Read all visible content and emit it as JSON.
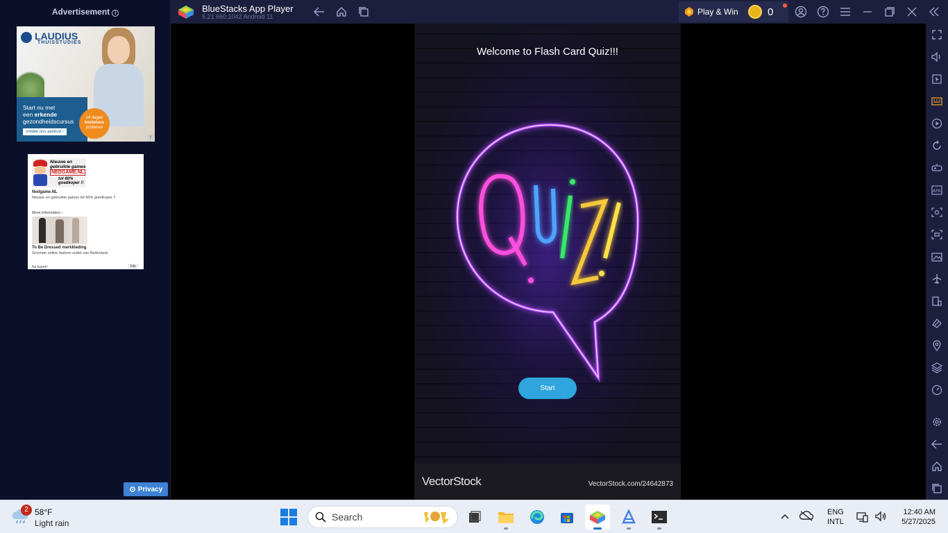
{
  "ad_panel": {
    "header": "Advertisement",
    "info_glyph": "i",
    "ad1": {
      "logo": "LAUDIUS",
      "logo_sub": "THUISSTUDIES",
      "line1": "Start nu met",
      "line2_pre": "een ",
      "line2_bold": "erkende",
      "line3": "gezondheidscursus",
      "cta": "ontdek ons aanbod",
      "badge_line1": "14 dagen",
      "badge_line2": "kosteloos",
      "badge_line3": "proberen"
    },
    "ad2": {
      "head_line1": "Nieuwe en",
      "head_line2": "gebruikte games",
      "brand_box": "NEDGAME.NL",
      "pct_line1": "tot 60%",
      "pct_line2": "goedkoper !!",
      "title": "Nedgame.NL",
      "desc": "Nieuwe en gebruikte games tot 60% goedkoper !!",
      "more": "More information",
      "title2": "To Be Dressed merkkleding",
      "desc2": "Grootste online fashion outlet van Nederland.",
      "foot": "Nu kopen!",
      "foot2": "Site"
    },
    "privacy_label": "Privacy"
  },
  "topbar": {
    "title": "BlueStacks App Player",
    "version": "5.21.660.1042  Android 11",
    "play_win": "Play & Win",
    "coins": "0"
  },
  "game": {
    "welcome": "Welcome to Flash Card Quiz!!!",
    "start_label": "Start",
    "vs_logo": "VectorStock",
    "vs_url": "VectorStock.com/24642873"
  },
  "taskbar": {
    "weather_badge": "2",
    "temp": "58°F",
    "condition": "Light rain",
    "search_placeholder": "Search",
    "lang_line1": "ENG",
    "lang_line2": "INTL",
    "time": "12:40 AM",
    "date": "5/27/2025"
  },
  "colors": {
    "topbar_bg": "#1c1f3c",
    "ad_panel_bg": "#0b0f2a",
    "start_button": "#2fa4dd",
    "privacy_button": "#3d82d4",
    "taskbar_bg": "#e9edf5"
  },
  "icons": {
    "topbar": [
      "back-arrow-icon",
      "home-icon",
      "recent-apps-icon",
      "account-icon",
      "help-icon",
      "menu-icon",
      "minimize-icon",
      "restore-icon",
      "close-icon",
      "collapse-sidebar-icon"
    ],
    "sidebar": [
      "fullscreen-icon",
      "volume-icon",
      "pointer-icon",
      "keyboard-icon",
      "macro-record-icon",
      "rotate-icon",
      "gamepad-icon",
      "apk-install-icon",
      "screenshot-icon",
      "screen-record-icon",
      "media-folder-icon",
      "airplane-mode-icon",
      "multi-instance-icon",
      "eco-mode-icon",
      "location-icon",
      "layers-icon",
      "performance-icon",
      "settings-icon",
      "back-icon",
      "home-icon",
      "recent-apps-icon"
    ],
    "taskbar": [
      "windows-start-icon",
      "search-icon",
      "file-manager-icon",
      "file-explorer-icon",
      "edge-icon",
      "store-icon",
      "bluestacks-icon",
      "bluestacks-x-icon",
      "terminal-icon",
      "chevron-up-icon",
      "cloud-offline-icon",
      "network-icon",
      "speaker-icon"
    ]
  }
}
